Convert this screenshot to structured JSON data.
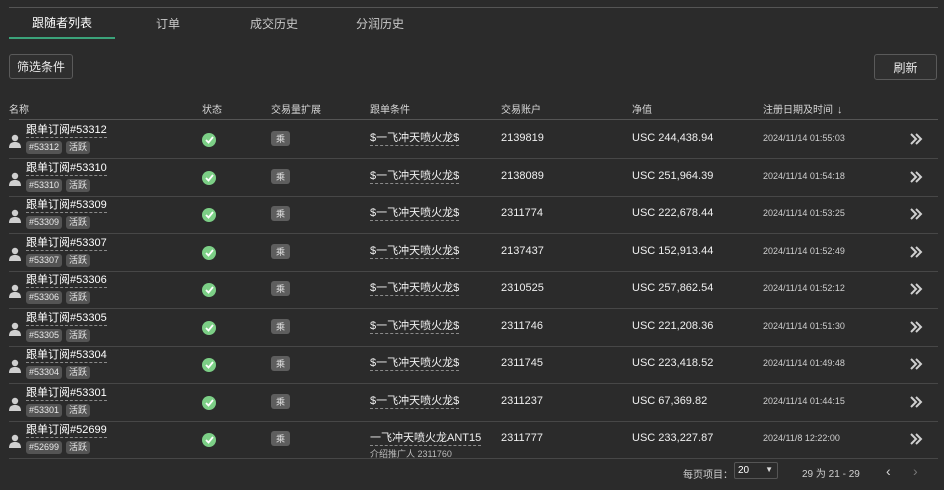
{
  "tabs": [
    {
      "label": "跟随者列表",
      "active": true
    },
    {
      "label": "订单",
      "active": false
    },
    {
      "label": "成交历史",
      "active": false
    },
    {
      "label": "分润历史",
      "active": false
    }
  ],
  "toolbar": {
    "filter_label": "筛选条件",
    "refresh_label": "刷新"
  },
  "table": {
    "headers": {
      "name": "名称",
      "status": "状态",
      "volume": "交易量扩展",
      "condition": "跟单条件",
      "account": "交易账户",
      "equity": "净值",
      "registered": "注册日期及时间",
      "sort_icon": "arrow-down-icon"
    },
    "rows": [
      {
        "name": "跟单订阅#53312",
        "tag": "#53312",
        "state": "活跃",
        "mult": "乘",
        "condition": "$一飞冲天喷火龙$",
        "sub": "",
        "account": "2139819",
        "equity": "USC 244,438.94",
        "date": "2024/11/14 01:55:03"
      },
      {
        "name": "跟单订阅#53310",
        "tag": "#53310",
        "state": "活跃",
        "mult": "乘",
        "condition": "$一飞冲天喷火龙$",
        "sub": "",
        "account": "2138089",
        "equity": "USC 251,964.39",
        "date": "2024/11/14 01:54:18"
      },
      {
        "name": "跟单订阅#53309",
        "tag": "#53309",
        "state": "活跃",
        "mult": "乘",
        "condition": "$一飞冲天喷火龙$",
        "sub": "",
        "account": "2311774",
        "equity": "USC 222,678.44",
        "date": "2024/11/14 01:53:25"
      },
      {
        "name": "跟单订阅#53307",
        "tag": "#53307",
        "state": "活跃",
        "mult": "乘",
        "condition": "$一飞冲天喷火龙$",
        "sub": "",
        "account": "2137437",
        "equity": "USC 152,913.44",
        "date": "2024/11/14 01:52:49"
      },
      {
        "name": "跟单订阅#53306",
        "tag": "#53306",
        "state": "活跃",
        "mult": "乘",
        "condition": "$一飞冲天喷火龙$",
        "sub": "",
        "account": "2310525",
        "equity": "USC 257,862.54",
        "date": "2024/11/14 01:52:12"
      },
      {
        "name": "跟单订阅#53305",
        "tag": "#53305",
        "state": "活跃",
        "mult": "乘",
        "condition": "$一飞冲天喷火龙$",
        "sub": "",
        "account": "2311746",
        "equity": "USC 221,208.36",
        "date": "2024/11/14 01:51:30"
      },
      {
        "name": "跟单订阅#53304",
        "tag": "#53304",
        "state": "活跃",
        "mult": "乘",
        "condition": "$一飞冲天喷火龙$",
        "sub": "",
        "account": "2311745",
        "equity": "USC 223,418.52",
        "date": "2024/11/14 01:49:48"
      },
      {
        "name": "跟单订阅#53301",
        "tag": "#53301",
        "state": "活跃",
        "mult": "乘",
        "condition": "$一飞冲天喷火龙$",
        "sub": "",
        "account": "2311237",
        "equity": "USC 67,369.82",
        "date": "2024/11/14 01:44:15"
      },
      {
        "name": "跟单订阅#52699",
        "tag": "#52699",
        "state": "活跃",
        "mult": "乘",
        "condition": "一飞冲天喷火龙ANT15",
        "sub": "介绍推广人 2311760",
        "account": "2311777",
        "equity": "USC 233,227.87",
        "date": "2024/11/8 12:22:00"
      }
    ]
  },
  "pagination": {
    "per_page_label": "每页项目：",
    "per_page_value": "20",
    "range_text": "29 为 21 - 29",
    "prev_icon": "chevron-left-icon",
    "next_icon": "chevron-right-icon"
  },
  "colors": {
    "accent": "#3ba37a",
    "status_ok": "#7ccf86",
    "background": "#2b2b2b"
  }
}
